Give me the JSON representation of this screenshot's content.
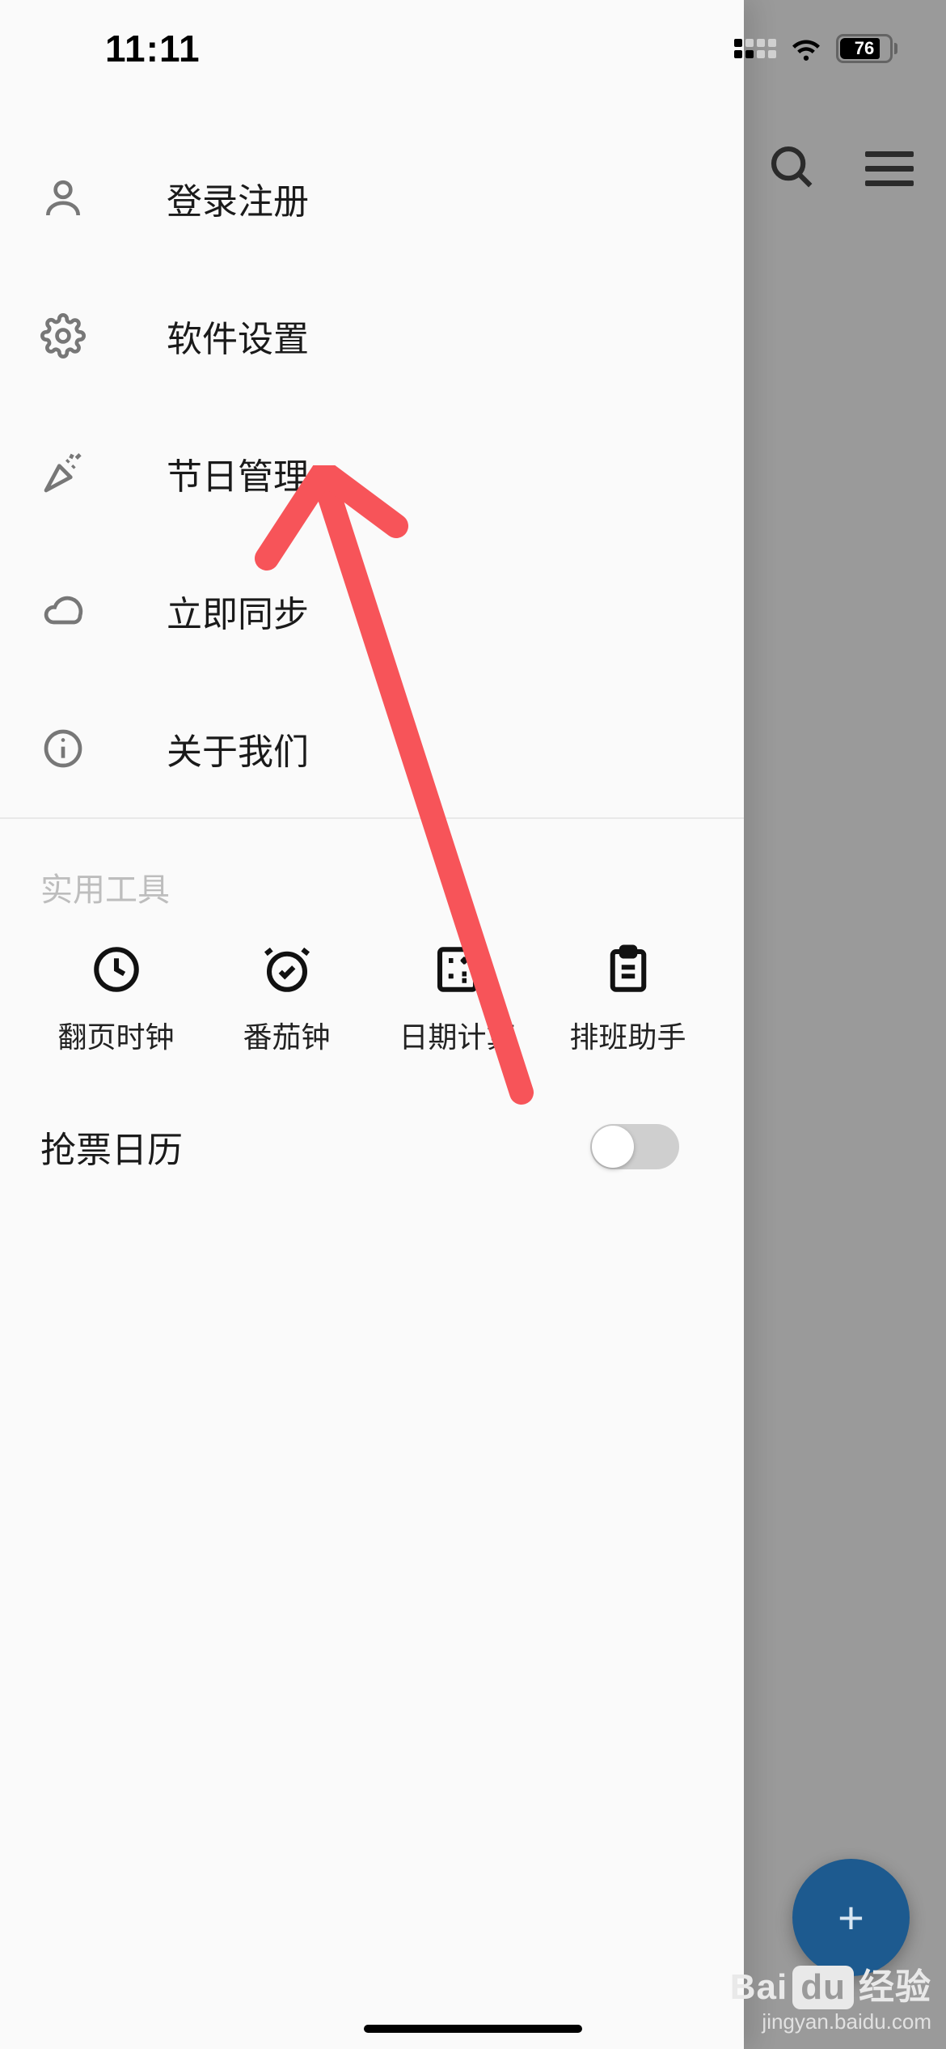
{
  "status": {
    "time": "11:11",
    "battery": "76"
  },
  "drawer": {
    "menu": [
      {
        "id": "login",
        "label": "登录注册"
      },
      {
        "id": "settings",
        "label": "软件设置"
      },
      {
        "id": "holiday",
        "label": "节日管理"
      },
      {
        "id": "sync",
        "label": "立即同步"
      },
      {
        "id": "about",
        "label": "关于我们"
      }
    ],
    "tools_title": "实用工具",
    "tools": [
      {
        "id": "flipclock",
        "label": "翻页时钟"
      },
      {
        "id": "pomodoro",
        "label": "番茄钟"
      },
      {
        "id": "datecalc",
        "label": "日期计算"
      },
      {
        "id": "shift",
        "label": "排班助手"
      }
    ],
    "ticket_toggle": {
      "label": "抢票日历",
      "on": false
    }
  },
  "watermark": {
    "brand_left": "Bai",
    "brand_box": "du",
    "brand_right": "经验",
    "url": "jingyan.baidu.com"
  }
}
